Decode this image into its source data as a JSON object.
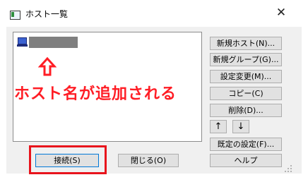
{
  "window": {
    "title": "ホスト一覧",
    "close_glyph": "✕"
  },
  "list": {
    "items": [
      {
        "icon": "computer-icon",
        "name_redacted": true
      }
    ]
  },
  "annotation": {
    "text": "ホスト名が追加される",
    "color": "#ff1d25"
  },
  "buttons": {
    "new_host": "新規ホスト(N)...",
    "new_group": "新規グループ(G)...",
    "change_settings": "設定変更(M)...",
    "copy": "コピー(C)",
    "delete": "削除(D)...",
    "move_up": "↑",
    "move_down": "↓",
    "default_settings": "既定の設定(F)...",
    "connect": "接続(S)",
    "close": "閉じる(O)",
    "help": "ヘルプ"
  },
  "colors": {
    "highlight": "#e8141c",
    "focus": "#0078d7",
    "button_face": "#e1e1e1",
    "dialog_bg": "#f0f0f0"
  }
}
